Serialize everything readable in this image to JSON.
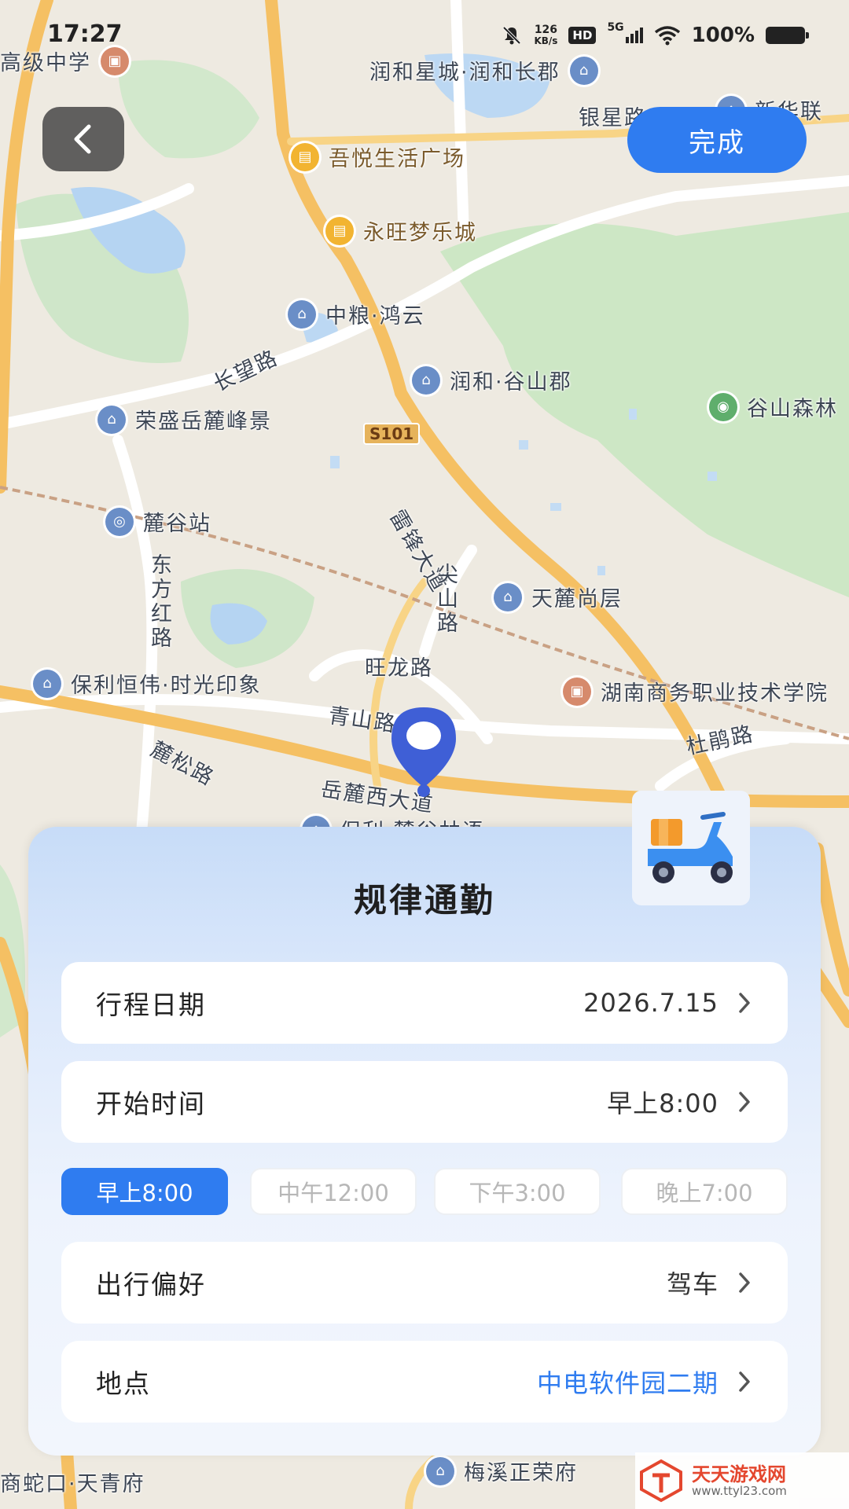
{
  "status_bar": {
    "time": "17:27",
    "speed_value": "126",
    "speed_unit": "KB/s",
    "hd": "HD",
    "network": "5G",
    "battery": "100%"
  },
  "map": {
    "labels": {
      "school": "高级中学",
      "runhe_xingcheng": "润和星城·润和长郡",
      "yinxing_road": "银星路",
      "xinhua": "新华联",
      "wuyue": "吾悦生活广场",
      "yongwang": "永旺梦乐城",
      "zhongliang": "中粮·鸿云",
      "changwang_road": "长望路",
      "runhe_gushan": "润和·谷山郡",
      "gushan_forest": "谷山森林",
      "rongsheng": "荣盛岳麓峰景",
      "s101": "S101",
      "leifeng_road": "雷锋大道",
      "lugu_station": "麓谷站",
      "dongfanghong_road": "东方红路",
      "jianshan_road": "尖山路",
      "tianlu": "天麓尚层",
      "baoli_hengwei": "保利恒伟·时光印象",
      "wanglong_road": "旺龙路",
      "hunan_college": "湖南商务职业技术学院",
      "qingshan_road": "青山路",
      "dujuan_road": "杜鹃路",
      "lusong_road": "麓松路",
      "yuelu_west": "岳麓西大道",
      "baoli_lugu": "保利·麓谷林语",
      "shekou": "商蛇口·天青府",
      "meixi": "梅溪正荣府"
    }
  },
  "header": {
    "done_label": "完成"
  },
  "panel": {
    "title": "规律通勤",
    "rows": [
      {
        "label": "行程日期",
        "value": "2026.7.15"
      },
      {
        "label": "开始时间",
        "value": "早上8:00"
      },
      {
        "label": "出行偏好",
        "value": "驾车"
      },
      {
        "label": "地点",
        "value": "中电软件园二期"
      }
    ],
    "time_chips": [
      {
        "label": "早上8:00",
        "selected": true
      },
      {
        "label": "中午12:00",
        "selected": false
      },
      {
        "label": "下午3:00",
        "selected": false
      },
      {
        "label": "晚上7:00",
        "selected": false
      }
    ]
  },
  "watermark": {
    "title": "天天游戏网",
    "url": "www.ttyl23.com"
  },
  "colors": {
    "accent": "#2f7cf0",
    "pin": "#3f5fd6",
    "location_value": "#2f7cf0"
  },
  "icons": {
    "back": "chevron-left-icon",
    "row_arrow": "chevron-right-icon",
    "pin": "map-pin-icon",
    "scooter": "delivery-scooter-icon"
  }
}
